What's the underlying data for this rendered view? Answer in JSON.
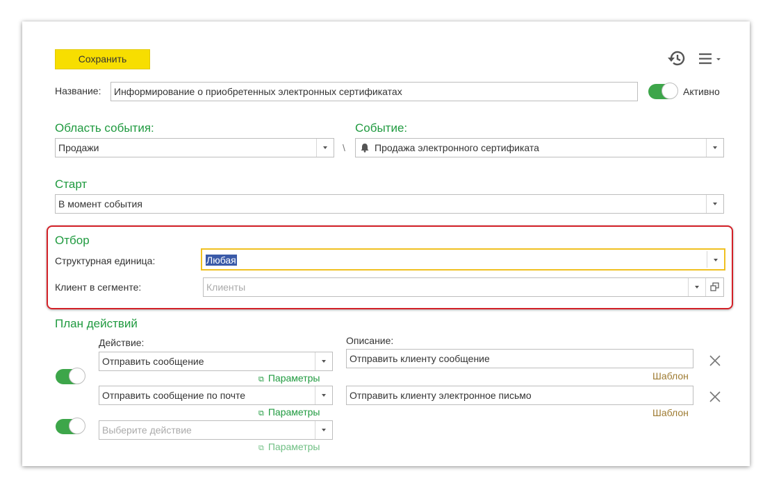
{
  "toolbar": {
    "save_label": "Сохранить",
    "history_icon": "history-icon",
    "menu_icon": "hamburger-menu-icon"
  },
  "name_row": {
    "label": "Название:",
    "value": "Информирование о приобретенных электронных сертификатах",
    "active_label": "Активно"
  },
  "event_area": {
    "heading": "Область события:",
    "value": "Продажи",
    "separator": "\\"
  },
  "event": {
    "heading": "Событие:",
    "value": "Продажа электронного сертификата",
    "icon": "bell-icon"
  },
  "start": {
    "heading": "Старт",
    "value": "В момент события"
  },
  "filter": {
    "heading": "Отбор",
    "unit_label": "Структурная единица:",
    "unit_value": "Любая",
    "client_label": "Клиент в сегменте:",
    "client_placeholder": "Клиенты"
  },
  "plan": {
    "heading": "План действий",
    "action_header": "Действие:",
    "description_header": "Описание:",
    "rows": [
      {
        "action": "Отправить сообщение",
        "params": "Параметры",
        "description": "Отправить клиенту сообщение",
        "template": "Шаблон"
      },
      {
        "action": "Отправить сообщение по почте",
        "params": "Параметры",
        "description": "Отправить клиенту электронное письмо",
        "template": "Шаблон"
      }
    ],
    "new_action_placeholder": "Выберите действие",
    "new_params": "Параметры"
  },
  "colors": {
    "accent_green": "#1f9a3f",
    "save_yellow": "#f7de00",
    "highlight_red": "#d32027",
    "template_brown": "#9e7b32"
  }
}
